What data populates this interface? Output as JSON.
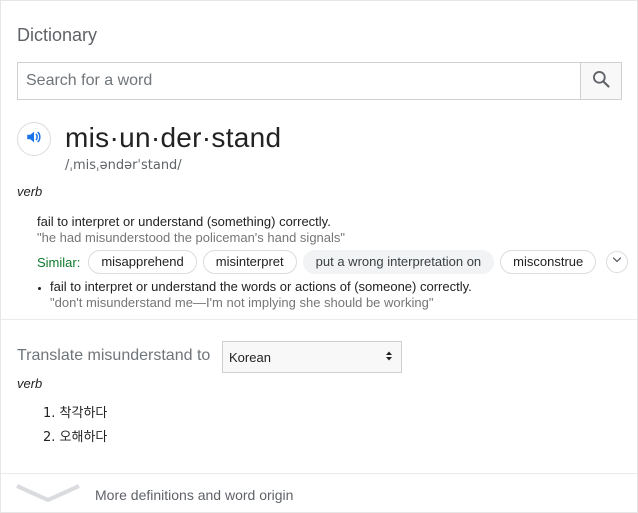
{
  "header": {
    "title": "Dictionary"
  },
  "search": {
    "placeholder": "Search for a word",
    "value": ""
  },
  "entry": {
    "headword": "mis·un·der·stand",
    "phonetic": "/ˌmisˌəndərˈstand/",
    "part_of_speech": "verb",
    "senses": [
      {
        "definition": "fail to interpret or understand (something) correctly.",
        "example": "\"he had misunderstood the policeman's hand signals\""
      },
      {
        "definition": "fail to interpret or understand the words or actions of (someone) correctly.",
        "example": "\"don't misunderstand me—I'm not implying she should be working\""
      }
    ],
    "similar": {
      "label": "Similar:",
      "words": [
        "misapprehend",
        "misinterpret",
        "put a wrong interpretation on",
        "misconstrue"
      ]
    }
  },
  "translate": {
    "label": "Translate misunderstand to",
    "language": "Korean",
    "part_of_speech": "verb",
    "items": [
      "1. 착각하다",
      "2. 오해하다"
    ]
  },
  "footer": {
    "more_label": "More definitions and word origin"
  },
  "colors": {
    "similar_label": "#0d7a2c",
    "speaker_icon": "#1a73e8",
    "muted_text": "#767676"
  }
}
